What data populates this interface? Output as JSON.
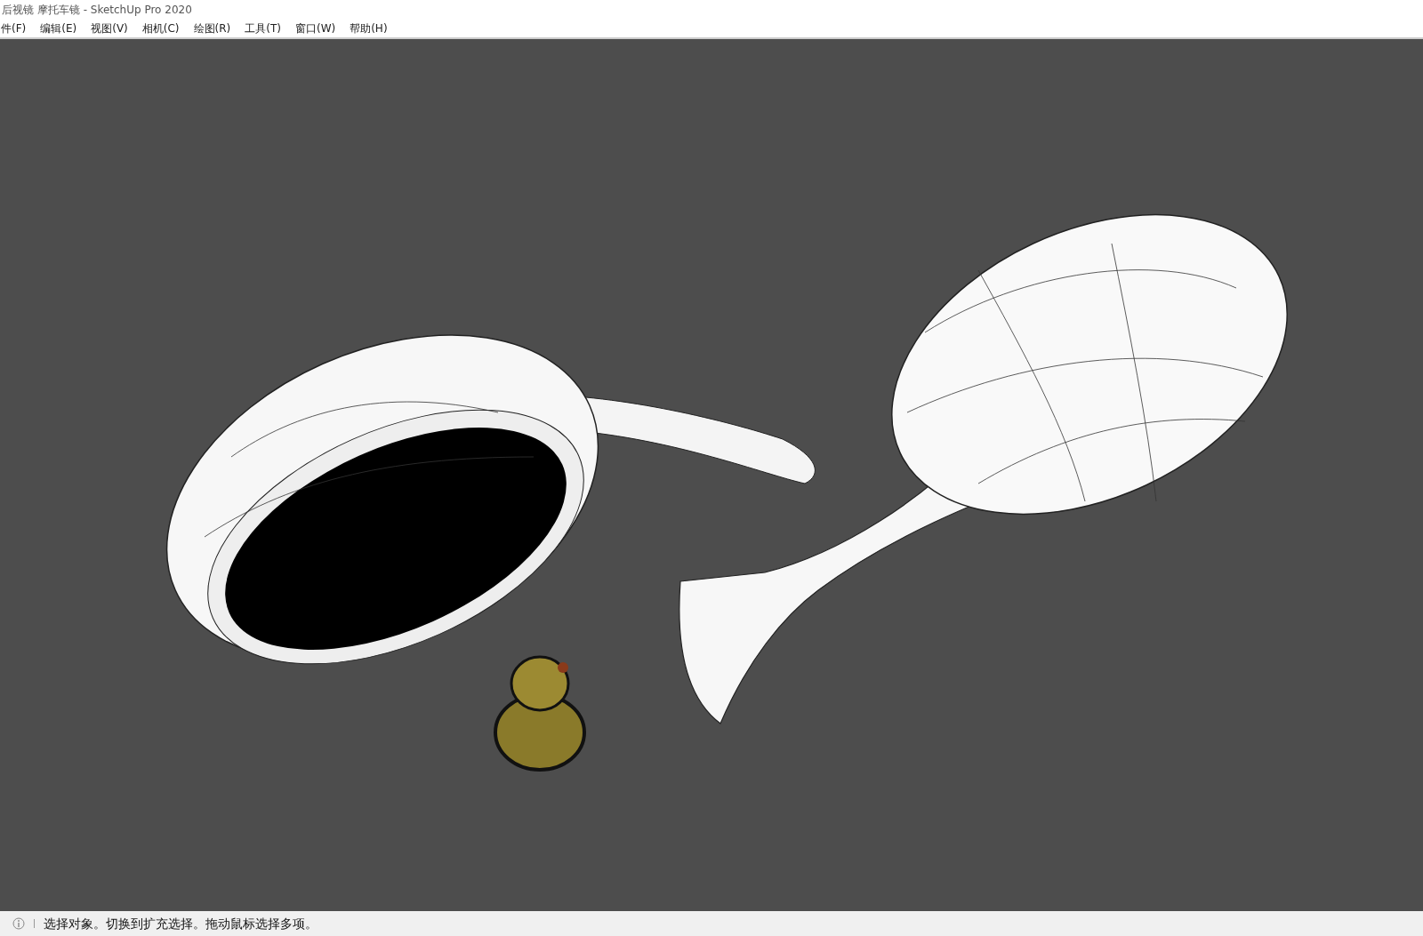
{
  "window": {
    "title": "后视镜 摩托车镜 - SketchUp Pro 2020"
  },
  "menu": [
    "件(F)",
    "编辑(E)",
    "视图(V)",
    "相机(C)",
    "绘图(R)",
    "工具(T)",
    "窗口(W)",
    "帮助(H)"
  ],
  "status_bar": {
    "message": "选择对象。切换到扩充选择。拖动鼠标选择多项。"
  }
}
